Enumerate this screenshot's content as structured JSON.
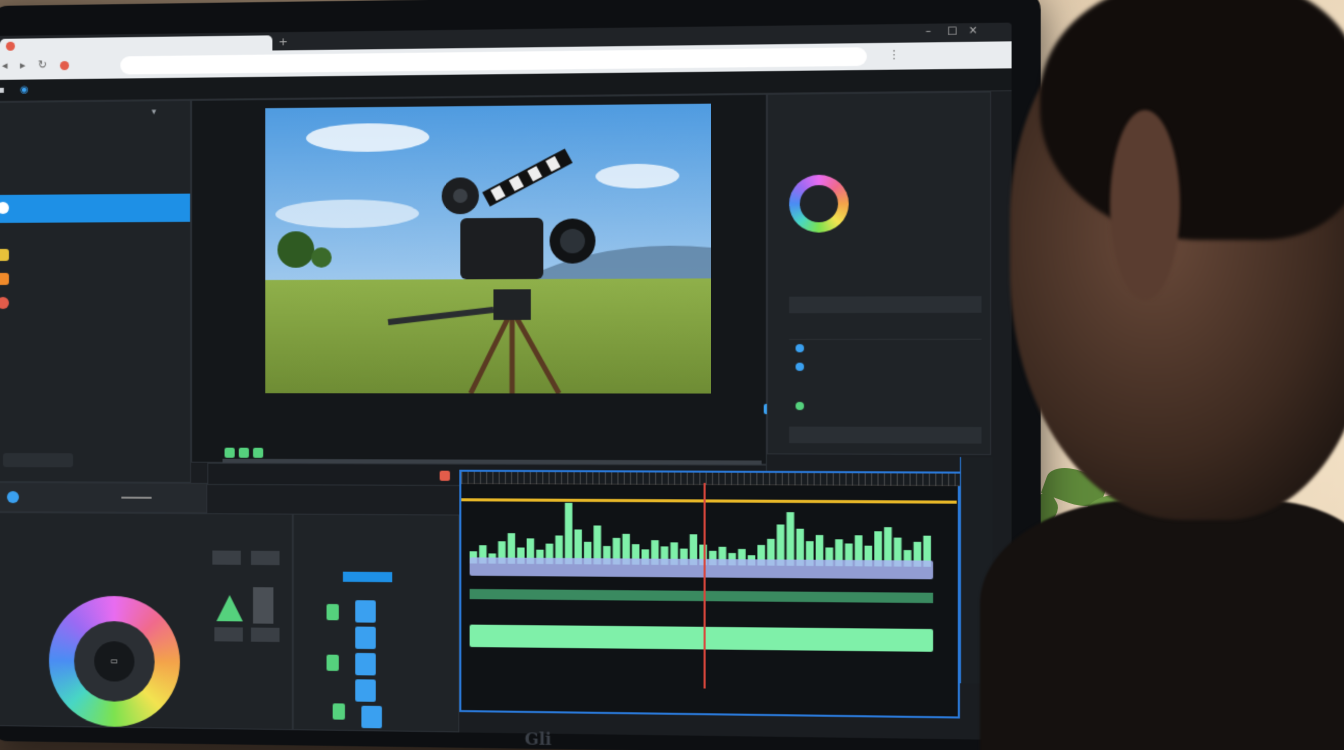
{
  "monitor": {
    "brand": "Gli"
  },
  "chart_data": {
    "type": "bar",
    "series": [
      {
        "values": [
          12,
          18,
          10,
          22,
          30,
          16,
          25,
          14,
          20,
          28,
          60,
          34,
          22,
          38,
          18,
          26,
          30,
          20,
          15,
          24,
          18,
          22,
          16,
          30,
          20,
          14,
          18,
          12,
          16,
          10,
          20,
          26,
          40,
          52,
          36,
          24,
          30,
          18,
          26,
          22,
          30,
          20,
          34,
          38,
          28,
          16,
          24,
          30
        ]
      }
    ]
  },
  "colors": {
    "accent": "#1e90e6",
    "timeline_border": "#2a79d9",
    "audio_green": "#7ff0a9",
    "playhead": "#d8463c",
    "yellow_marker": "#e7b728"
  },
  "icons": [
    "record-dot-icon",
    "chevron-icon",
    "close-icon",
    "gear-icon",
    "play-icon",
    "color-wheel-icon",
    "triangle-marker-icon",
    "scrollbar-icon"
  ],
  "timeline": {
    "waveform_count": 48
  }
}
